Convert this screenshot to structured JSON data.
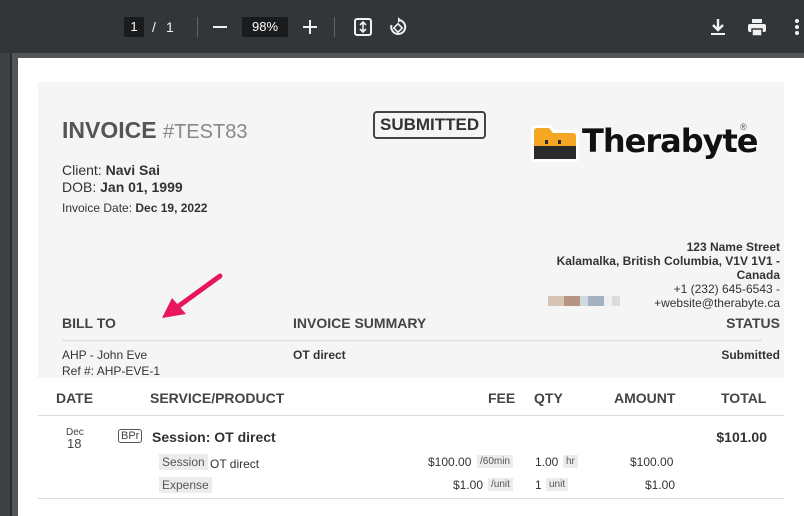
{
  "toolbar": {
    "page_current": "1",
    "page_separator": "/",
    "page_total": "1",
    "zoom": "98%",
    "icons": [
      "minus-icon",
      "plus-icon",
      "fit-page-icon",
      "rotate-icon",
      "download-icon",
      "print-icon",
      "more-vert-icon"
    ]
  },
  "invoice": {
    "title": "INVOICE",
    "number": "#TEST83",
    "status_badge": "SUBMITTED",
    "client_label": "Client:",
    "client_name": "Navi Sai",
    "dob_label": "DOB:",
    "dob": "Jan 01, 1999",
    "date_label": "Invoice Date:",
    "date": "Dec 19, 2022"
  },
  "brand": {
    "name": "Therabyte",
    "registered": "®",
    "logo_color": "#f5a623"
  },
  "address": {
    "line1": "123 Name Street",
    "line2": "Kalamalka, British Columbia, V1V 1V1 -",
    "line3": "Canada",
    "phone": "+1 (232) 645-6543 -",
    "email": "+website@therabyte.ca"
  },
  "summary": {
    "bill_to_heading": "BILL TO",
    "summary_heading": "INVOICE SUMMARY",
    "status_heading": "STATUS",
    "bill_to_name": "AHP - John Eve",
    "ref": "Ref #: AHP-EVE-1",
    "summary_value": "OT direct",
    "status_value": "Submitted"
  },
  "table": {
    "headers": {
      "date": "DATE",
      "service": "SERVICE/PRODUCT",
      "fee": "FEE",
      "qty": "QTY",
      "amount": "AMOUNT",
      "total": "TOTAL"
    },
    "row": {
      "month": "Dec",
      "day": "18",
      "type_badge": "BPr",
      "session_title": "Session: OT direct",
      "total": "$101.00",
      "lines": [
        {
          "tag": "Session",
          "desc": "OT direct",
          "fee": "$100.00",
          "fee_unit": "/60min",
          "qty": "1.00",
          "qty_unit": "hr",
          "amount": "$100.00"
        },
        {
          "tag": "Expense",
          "desc": "",
          "fee": "$1.00",
          "fee_unit": "/unit",
          "qty": "1",
          "qty_unit": "unit",
          "amount": "$1.00"
        }
      ]
    }
  },
  "annotation": {
    "arrow_color": "#e8175d"
  }
}
